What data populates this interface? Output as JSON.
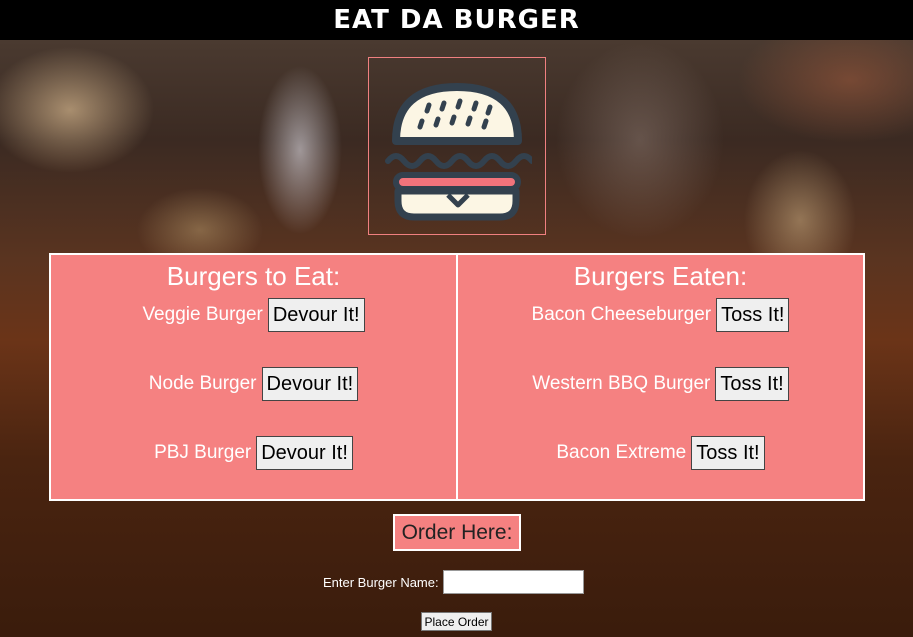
{
  "app": {
    "title": "EAT DA BURGER"
  },
  "logo": {
    "icon": "burger-icon"
  },
  "to_eat": {
    "heading": "Burgers to Eat:",
    "items": [
      {
        "name": "Veggie Burger",
        "action": "Devour It!"
      },
      {
        "name": "Node Burger",
        "action": "Devour It!"
      },
      {
        "name": "PBJ Burger",
        "action": "Devour It!"
      }
    ]
  },
  "eaten": {
    "heading": "Burgers Eaten:",
    "items": [
      {
        "name": "Bacon Cheeseburger",
        "action": "Toss It!"
      },
      {
        "name": "Western BBQ Burger",
        "action": "Toss It!"
      },
      {
        "name": "Bacon Extreme",
        "action": "Toss It!"
      }
    ]
  },
  "order": {
    "heading": "Order Here:",
    "label": "Enter Burger Name:",
    "input_value": "",
    "submit_label": "Place Order"
  },
  "colors": {
    "panel": "#f58181",
    "topbar": "#000000",
    "bun": "#fcf6e4",
    "patty_outline": "#33414e",
    "tomato": "#f2737b"
  }
}
